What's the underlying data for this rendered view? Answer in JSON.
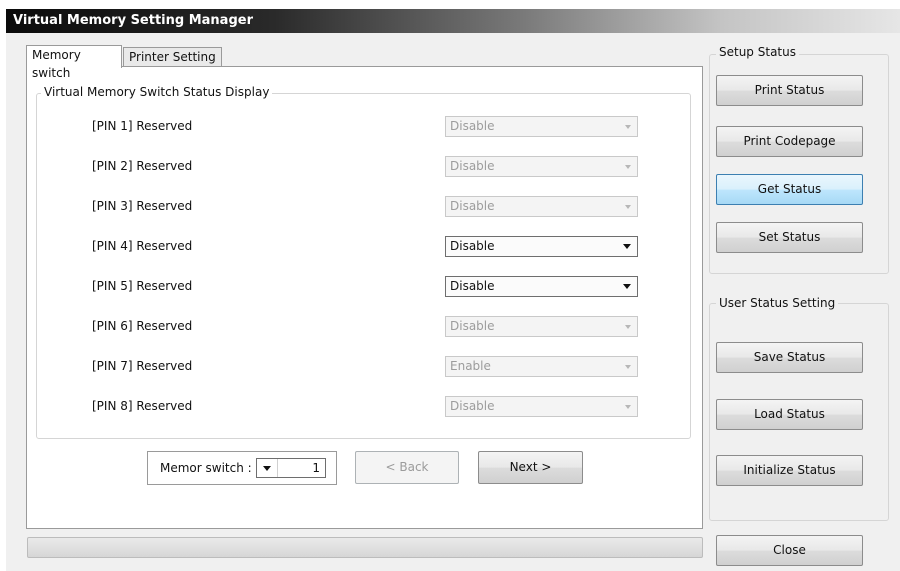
{
  "window": {
    "title": "Virtual Memory Setting Manager"
  },
  "tabs": [
    {
      "label": "Memory switch",
      "active": true
    },
    {
      "label": "Printer Setting",
      "active": false
    }
  ],
  "status_group": {
    "label": "Virtual Memory Switch Status Display"
  },
  "pins": [
    {
      "label": "[PIN 1] Reserved",
      "value": "Disable",
      "enabled": false
    },
    {
      "label": "[PIN 2] Reserved",
      "value": "Disable",
      "enabled": false
    },
    {
      "label": "[PIN 3] Reserved",
      "value": "Disable",
      "enabled": false
    },
    {
      "label": "[PIN 4] Reserved",
      "value": "Disable",
      "enabled": true
    },
    {
      "label": "[PIN 5] Reserved",
      "value": "Disable",
      "enabled": true
    },
    {
      "label": "[PIN 6] Reserved",
      "value": "Disable",
      "enabled": false
    },
    {
      "label": "[PIN 7] Reserved",
      "value": "Enable",
      "enabled": false
    },
    {
      "label": "[PIN 8] Reserved",
      "value": "Disable",
      "enabled": false
    }
  ],
  "memor_switch": {
    "label": "Memor switch :",
    "value": "1"
  },
  "nav": {
    "back_label": "< Back",
    "next_label": "Next >"
  },
  "setup": {
    "label": "Setup Status",
    "print_status": "Print Status",
    "print_codepage": "Print Codepage",
    "get_status": "Get Status",
    "set_status": "Set Status"
  },
  "user": {
    "label": "User Status Setting",
    "save_status": "Save Status",
    "load_status": "Load Status",
    "initialize_status": "Initialize Status"
  },
  "close_label": "Close",
  "progress": {
    "value": 0
  },
  "colors": {
    "progress_fill": "#25b04a",
    "focus_border": "#3c7fb1"
  }
}
